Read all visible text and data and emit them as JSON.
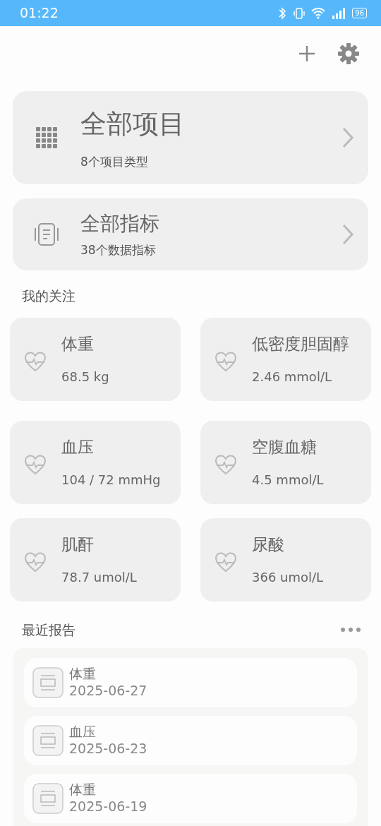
{
  "status_bar": {
    "time": "01:22",
    "battery": "96"
  },
  "summary_cards": [
    {
      "kind": "grid",
      "title": "全部项目",
      "subtitle": "8个项目类型"
    },
    {
      "kind": "document",
      "title": "全部指标",
      "subtitle": "38个数据指标"
    }
  ],
  "favorites": {
    "title": "我的关注",
    "items": [
      {
        "name": "体重",
        "value": "68.5 kg"
      },
      {
        "name": "低密度胆固醇",
        "value": "2.46 mmol/L"
      },
      {
        "name": "血压",
        "value": "104 / 72 mmHg"
      },
      {
        "name": "空腹血糖",
        "value": "4.5 mmol/L"
      },
      {
        "name": "肌酐",
        "value": "78.7 umol/L"
      },
      {
        "name": "尿酸",
        "value": "366 umol/L"
      }
    ]
  },
  "recent_reports": {
    "title": "最近报告",
    "items": [
      {
        "name": "体重",
        "date": "2025-06-27"
      },
      {
        "name": "血压",
        "date": "2025-06-23"
      },
      {
        "name": "体重",
        "date": "2025-06-19"
      }
    ]
  }
}
